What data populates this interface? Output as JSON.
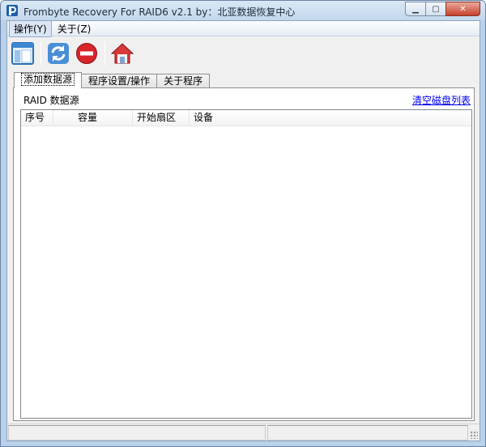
{
  "window": {
    "title": "Frombyte Recovery For RAID6 v2.1 by：北亚数据恢复中心",
    "minimize_label": "▁",
    "maximize_label": "▢",
    "close_label": "✕"
  },
  "menu": {
    "items": [
      {
        "label": "操作(Y)"
      },
      {
        "label": "关于(Z)"
      }
    ]
  },
  "toolbar": {
    "buttons": [
      {
        "icon": "window-layout-icon"
      },
      {
        "icon": "refresh-icon"
      },
      {
        "icon": "stop-icon"
      },
      {
        "icon": "home-icon"
      }
    ]
  },
  "tabs": [
    {
      "label": "添加数据源",
      "selected": true
    },
    {
      "label": "程序设置/操作",
      "selected": false
    },
    {
      "label": "关于程序",
      "selected": false
    }
  ],
  "panel": {
    "section_label": "RAID 数据源",
    "clear_link": "清空磁盘列表",
    "columns": [
      "序号",
      "容量",
      "开始扇区",
      "设备"
    ],
    "rows": []
  },
  "colors": {
    "link": "#0000ee",
    "titlebar": "#c3d7ec",
    "close_button": "#c7402b"
  }
}
